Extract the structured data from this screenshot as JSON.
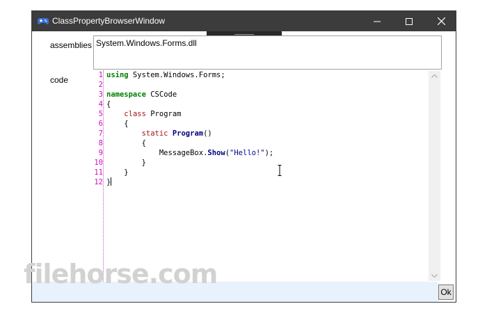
{
  "window": {
    "title": "ClassPropertyBrowserWindow"
  },
  "labels": {
    "assemblies": "assemblies",
    "code": "code"
  },
  "assemblies_value": "System.Windows.Forms.dll",
  "code": {
    "line_numbers": [
      "1",
      "2",
      "3",
      "4",
      "5",
      "6",
      "7",
      "8",
      "9",
      "10",
      "11",
      "12"
    ],
    "lines": {
      "l1_kw": "using",
      "l1_rest": " System.Windows.Forms;",
      "l3_kw": "namespace",
      "l3_rest": " CSCode",
      "l4": "{",
      "l5_kw": "class",
      "l5_name": "Program",
      "l6": "{",
      "l7_kw": "static",
      "l7_name": "Program",
      "l7_rest": "()",
      "l8": "{",
      "l9_obj": "MessageBox.",
      "l9_fn": "Show",
      "l9_open": "(",
      "l9_str": "\"Hello!\"",
      "l9_close": ");",
      "l10": "}",
      "l11": "}",
      "l12": "}"
    }
  },
  "ok_label": "Ok",
  "watermark": "filehorse.com",
  "colors": {
    "titlebar": "#3c3c3c",
    "line_numbers": "#d010c0",
    "keyword_green": "#008000",
    "keyword_red": "#a31515",
    "string": "#00008b"
  },
  "icons": {
    "app": "gamepad-icon",
    "minimize": "minimize-icon",
    "maximize": "maximize-icon",
    "close": "close-icon"
  }
}
